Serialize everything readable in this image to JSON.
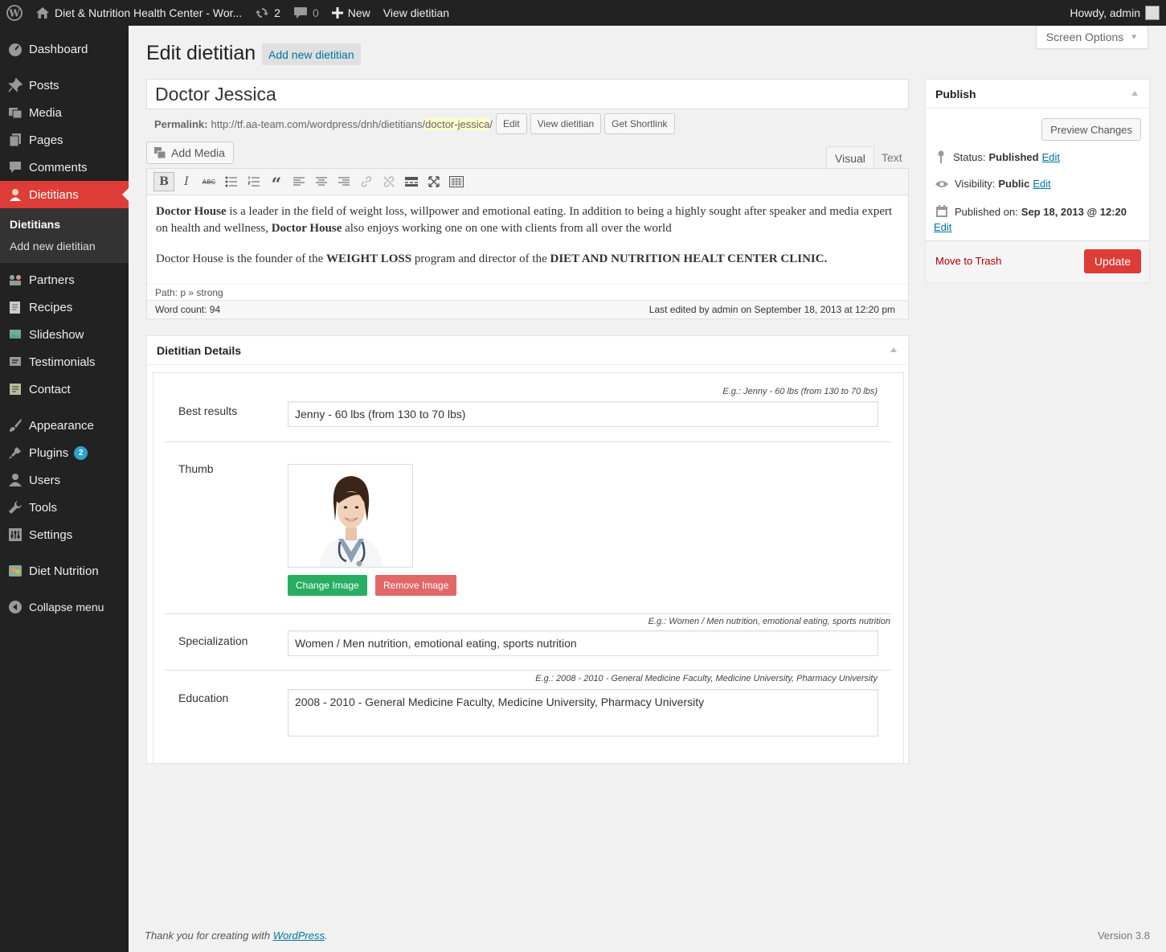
{
  "adminbar": {
    "site_name": "Diet & Nutrition Health Center - Wor...",
    "updates_count": "2",
    "comments_count": "0",
    "new_label": "New",
    "view_label": "View dietitian",
    "howdy": "Howdy, admin"
  },
  "sidebar": {
    "dashboard": "Dashboard",
    "posts": "Posts",
    "media": "Media",
    "pages": "Pages",
    "comments": "Comments",
    "dietitians": "Dietitians",
    "sub_dietitians": "Dietitians",
    "sub_add_new": "Add new dietitian",
    "partners": "Partners",
    "recipes": "Recipes",
    "slideshow": "Slideshow",
    "testimonials": "Testimonials",
    "contact": "Contact",
    "appearance": "Appearance",
    "plugins": "Plugins",
    "plugins_badge": "2",
    "users": "Users",
    "tools": "Tools",
    "settings": "Settings",
    "diet_nutrition": "Diet Nutrition",
    "collapse": "Collapse menu"
  },
  "header": {
    "screen_options": "Screen Options",
    "title": "Edit dietitian",
    "add_new": "Add new dietitian"
  },
  "post": {
    "title": "Doctor Jessica",
    "permalink_label": "Permalink:",
    "permalink_base": "http://tf.aa-team.com/wordpress/dnh/dietitians/",
    "permalink_slug": "doctor-jessica",
    "permalink_end": "/",
    "edit_btn": "Edit",
    "view_btn": "View dietitian",
    "shortlink_btn": "Get Shortlink"
  },
  "editor": {
    "add_media": "Add Media",
    "tab_visual": "Visual",
    "tab_text": "Text",
    "p1_b1": "Doctor House",
    "p1_t1": " is a leader in the field of weight loss, willpower and emotional eating. In addition to being a highly sought after speaker and media expert on health and wellness, ",
    "p1_b2": "Doctor House",
    "p1_t2": " also enjoys working one on one with clients from all over the world",
    "p2_t1": "Doctor House is the founder of the ",
    "p2_b1": "WEIGHT LOSS",
    "p2_t2": " program and director of the ",
    "p2_b2": "DIET AND NUTRITION HEALT CENTER CLINIC.",
    "path": "Path: p » strong",
    "word_count": "Word count: 94",
    "last_edited": "Last edited by admin on September 18, 2013 at 12:20 pm"
  },
  "details": {
    "title": "Dietitian Details",
    "best_hint": "E.g.: Jenny - 60 lbs (from 130 to 70 lbs)",
    "best_label": "Best results",
    "best_value": "Jenny - 60 lbs (from 130 to 70 lbs)",
    "thumb_label": "Thumb",
    "change_image": "Change Image",
    "remove_image": "Remove Image",
    "spec_hint": "E.g.: Women / Men nutrition, emotional eating, sports nutrition",
    "spec_label": "Specialization",
    "spec_value": "Women / Men nutrition, emotional eating, sports nutrition",
    "edu_hint": "E.g.: 2008 - 2010 - General Medicine Faculty, Medicine University, Pharmacy University",
    "edu_label": "Education",
    "edu_value": "2008 - 2010 - General Medicine Faculty, Medicine University, Pharmacy University"
  },
  "publish": {
    "title": "Publish",
    "preview": "Preview Changes",
    "status_label": "Status:",
    "status_value": "Published",
    "visibility_label": "Visibility:",
    "visibility_value": "Public",
    "published_label": "Published on:",
    "published_value": "Sep 18, 2013 @ 12:20",
    "edit": "Edit",
    "trash": "Move to Trash",
    "update": "Update"
  },
  "footer": {
    "thanks": "Thank you for creating with ",
    "wp": "WordPress",
    "dot": ".",
    "version": "Version 3.8"
  },
  "colors": {
    "sidebar_bg": "#222222",
    "active_menu": "#dd3d36",
    "link": "#0074a2",
    "change_image_btn": "#27ae60",
    "remove_image_btn": "#e26868",
    "update_btn": "#dd3d36"
  }
}
